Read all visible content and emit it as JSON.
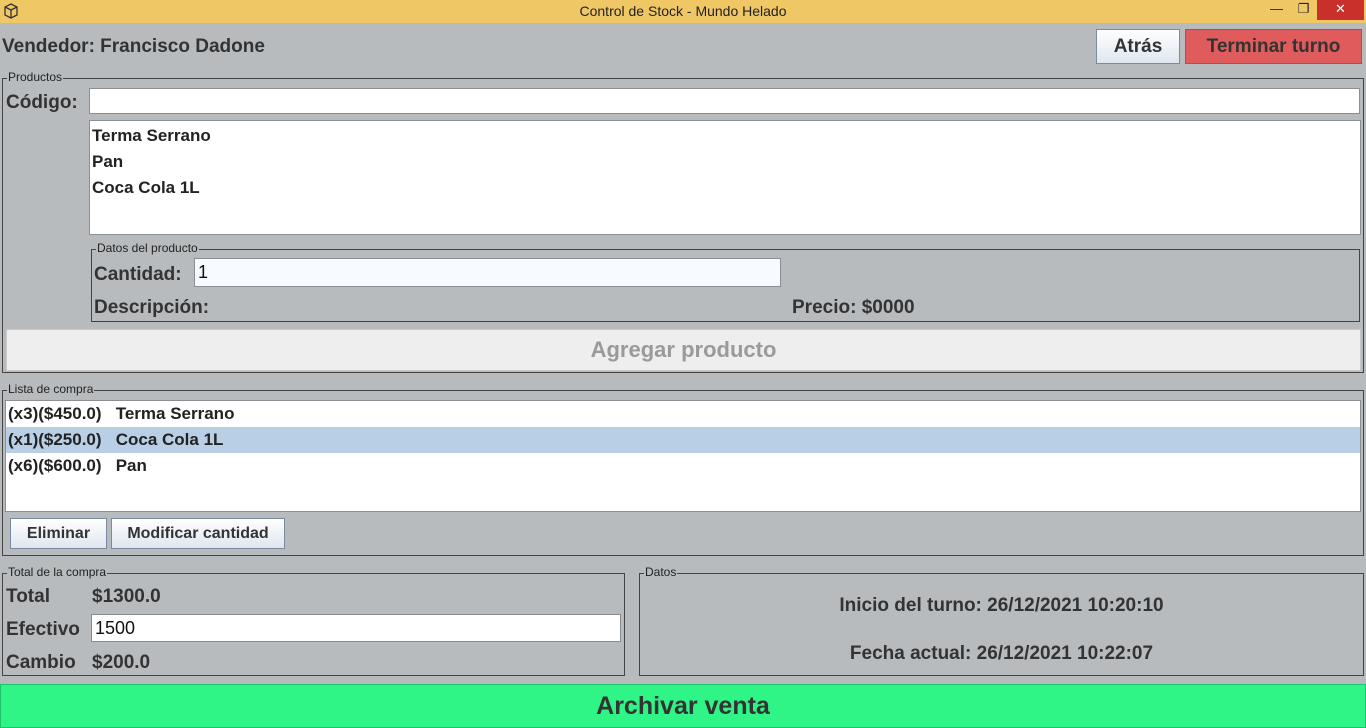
{
  "window": {
    "title": "Control de Stock - Mundo Helado",
    "minimize": "—",
    "maximize": "❐",
    "close": "✕",
    "icon": "app-box-icon"
  },
  "header": {
    "seller": "Vendedor: Francisco Dadone",
    "back_label": "Atrás",
    "end_shift_label": "Terminar turno",
    "end_shift_color": "#e05c5c"
  },
  "products": {
    "legend": "Productos",
    "code_label": "Código:",
    "code_value": "",
    "items": [
      "Terma Serrano",
      "Pan",
      "Coca Cola 1L"
    ],
    "details": {
      "legend": "Datos del producto",
      "quantity_label": "Cantidad:",
      "quantity_value": "1",
      "description_label": "Descripción:",
      "price_label": "Precio: $0000"
    },
    "add_label": "Agregar producto"
  },
  "purchase_list": {
    "legend": "Lista de compra",
    "items": [
      {
        "text": "(x3)($450.0)   Terma Serrano"
      },
      {
        "text": "(x1)($250.0)   Coca Cola 1L",
        "selected": true
      },
      {
        "text": "(x6)($600.0)   Pan"
      }
    ],
    "delete_label": "Eliminar",
    "modify_label": "Modificar cantidad"
  },
  "totals": {
    "legend": "Total de la compra",
    "total_label": "Total",
    "total_value": "$1300.0",
    "cash_label": "Efectivo",
    "cash_value": "1500",
    "change_label": "Cambio",
    "change_value": "$200.0"
  },
  "info": {
    "legend": "Datos",
    "shift_start": "Inicio del turno: 26/12/2021 10:20:10",
    "current_date": "Fecha actual: 26/12/2021 10:22:07"
  },
  "archive_label": "Archivar venta",
  "archive_color": "#2ef585"
}
